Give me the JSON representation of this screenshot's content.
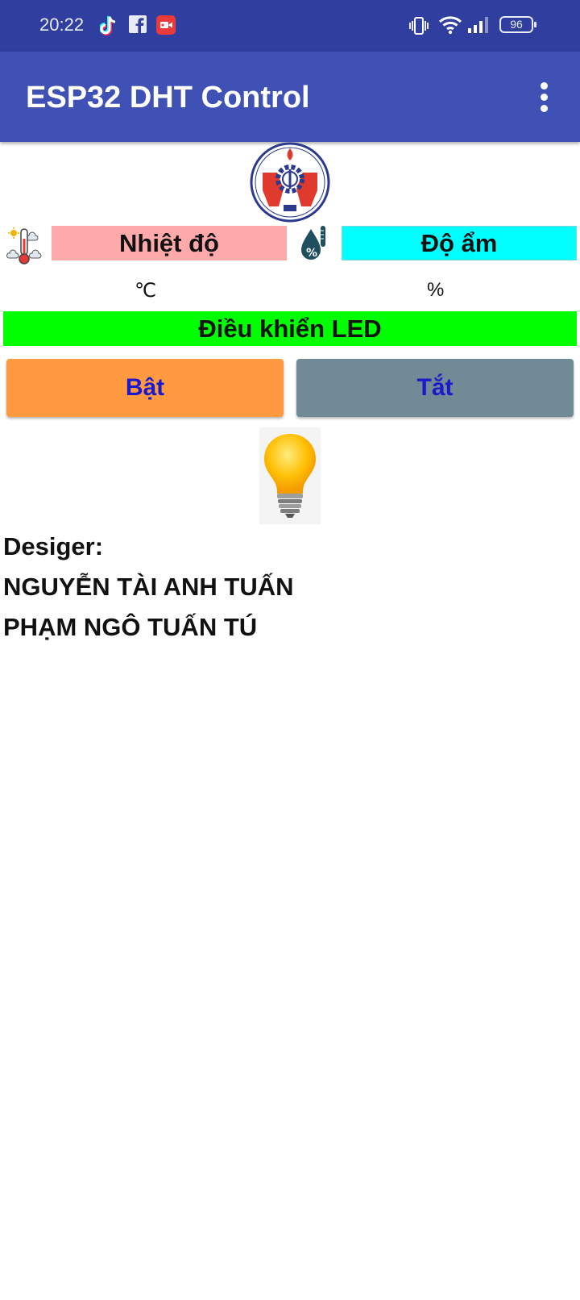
{
  "status_bar": {
    "time": "20:22",
    "battery": "96",
    "icons": [
      "tiktok-icon",
      "facebook-icon",
      "screen-recorder-icon",
      "vibrate-icon",
      "wifi-icon",
      "signal-icon",
      "battery-icon"
    ]
  },
  "app_bar": {
    "title": "ESP32 DHT Control",
    "menu_icon": "more-vert-icon"
  },
  "sensors": {
    "temperature_label": "Nhiệt độ",
    "temperature_unit": "℃",
    "humidity_label": "Độ ẩm",
    "humidity_unit": "%"
  },
  "led": {
    "section_label": "Điều khiển LED",
    "on_label": "Bật",
    "off_label": "Tắt"
  },
  "designers": {
    "heading": "Desiger:",
    "names": [
      "NGUYỄN TÀI ANH TUẤN",
      "PHẠM NGÔ TUẤN TÚ"
    ]
  },
  "colors": {
    "status_bar": "#303f9f",
    "app_bar": "#3f51b5",
    "temperature_bg": "#ffaaaa",
    "humidity_bg": "#00ffff",
    "led_bg": "#00ff00",
    "on_button": "#ff9a40",
    "off_button": "#708b96",
    "button_text": "#1a1acc"
  }
}
